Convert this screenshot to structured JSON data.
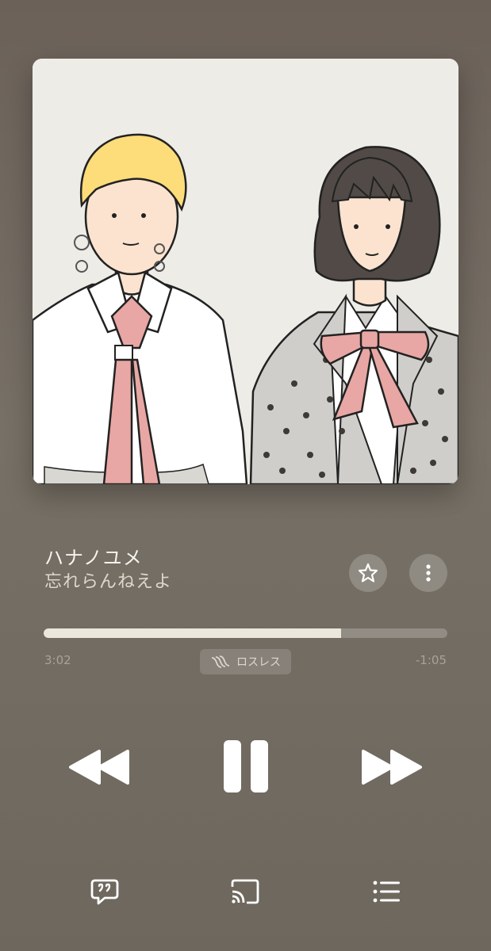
{
  "track": {
    "title": "ハナノユメ",
    "artist": "忘れらんねえよ"
  },
  "playback": {
    "elapsed": "3:02",
    "remaining": "-1:05",
    "progress_fraction": 0.736,
    "quality_label": "ロスレス",
    "state": "playing"
  },
  "icons": {
    "favorite": "star-outline-icon",
    "more": "more-vertical-icon",
    "previous": "rewind-icon",
    "play_pause": "pause-icon",
    "next": "fast-forward-icon",
    "lyrics": "lyrics-bubble-icon",
    "cast": "cast-icon",
    "queue": "queue-list-icon",
    "lossless": "lossless-wave-icon"
  },
  "colors": {
    "background": "#736b61",
    "progress_fill": "#ece7dc",
    "artwork_bg": "#eeece6"
  }
}
